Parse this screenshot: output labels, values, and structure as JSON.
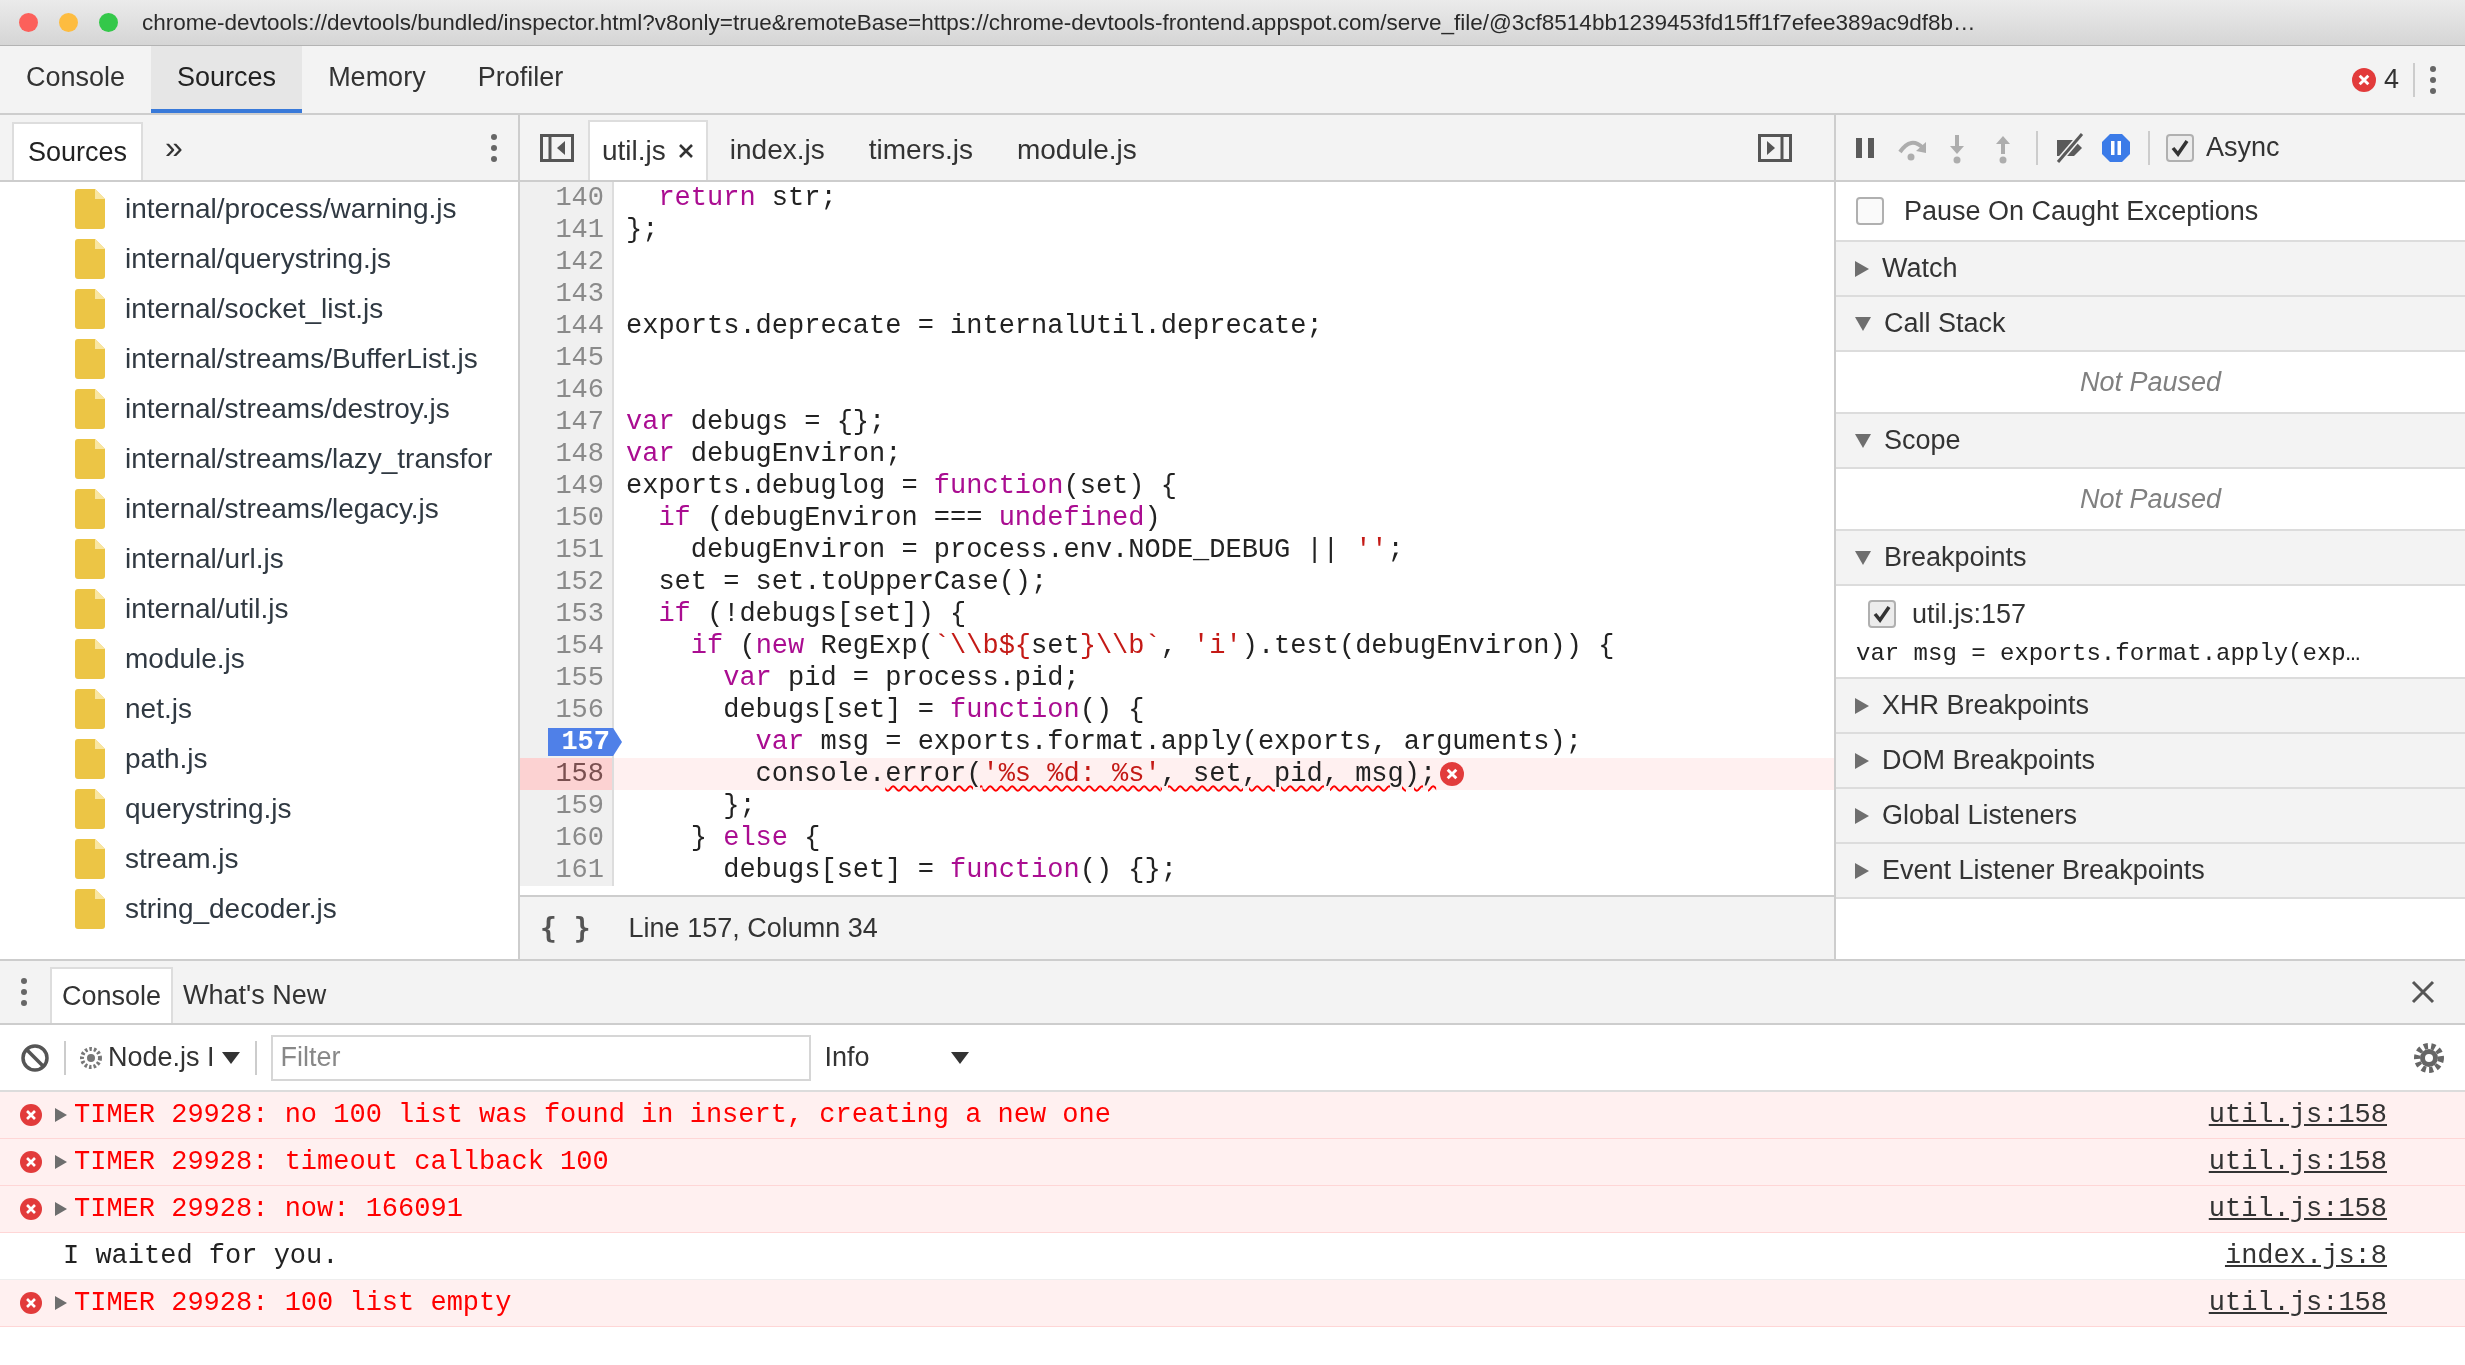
{
  "window": {
    "title": "chrome-devtools://devtools/bundled/inspector.html?v8only=true&remoteBase=https://chrome-devtools-frontend.appspot.com/serve_file/@3cf8514bb1239453fd15ff1f7efee389ac9df8b…"
  },
  "main_tabs": [
    {
      "label": "Console",
      "selected": false
    },
    {
      "label": "Sources",
      "selected": true
    },
    {
      "label": "Memory",
      "selected": false
    },
    {
      "label": "Profiler",
      "selected": false
    }
  ],
  "error_count": "4",
  "navigator": {
    "tabs": [
      {
        "label": "Sources",
        "selected": true
      }
    ],
    "more_tabs": "»",
    "files": [
      "internal/process/warning.js",
      "internal/querystring.js",
      "internal/socket_list.js",
      "internal/streams/BufferList.js",
      "internal/streams/destroy.js",
      "internal/streams/lazy_transfor",
      "internal/streams/legacy.js",
      "internal/url.js",
      "internal/util.js",
      "module.js",
      "net.js",
      "path.js",
      "querystring.js",
      "stream.js",
      "string_decoder.js"
    ]
  },
  "editor": {
    "tabs": [
      {
        "label": "util.js",
        "selected": true
      },
      {
        "label": "index.js",
        "selected": false
      },
      {
        "label": "timers.js",
        "selected": false
      },
      {
        "label": "module.js",
        "selected": false
      }
    ],
    "lines": [
      {
        "number": "140",
        "breakpoint": false,
        "error": false,
        "tokens": [
          {
            "text": "  return",
            "kind": "keyword"
          },
          {
            "text": " str;",
            "kind": "plain"
          }
        ]
      },
      {
        "number": "141",
        "breakpoint": false,
        "error": false,
        "tokens": [
          {
            "text": "};",
            "kind": "plain"
          }
        ]
      },
      {
        "number": "142",
        "breakpoint": false,
        "error": false
      },
      {
        "number": "143",
        "breakpoint": false,
        "error": false
      },
      {
        "number": "144",
        "breakpoint": false,
        "error": false,
        "tokens": [
          {
            "text": "exports.deprecate = internalUtil.deprecate;",
            "kind": "plain"
          }
        ]
      },
      {
        "number": "145",
        "breakpoint": false,
        "error": false
      },
      {
        "number": "146",
        "breakpoint": false,
        "error": false
      },
      {
        "number": "147",
        "breakpoint": false,
        "error": false,
        "tokens": [
          {
            "text": "var",
            "kind": "keyword"
          },
          {
            "text": " debugs = {};",
            "kind": "plain"
          }
        ]
      },
      {
        "number": "148",
        "breakpoint": false,
        "error": false,
        "tokens": [
          {
            "text": "var",
            "kind": "keyword"
          },
          {
            "text": " debugEnviron;",
            "kind": "plain"
          }
        ]
      },
      {
        "number": "149",
        "breakpoint": false,
        "error": false,
        "tokens": [
          {
            "text": "exports.debuglog = ",
            "kind": "plain"
          },
          {
            "text": "function",
            "kind": "keyword"
          },
          {
            "text": "(set) {",
            "kind": "plain"
          }
        ]
      },
      {
        "number": "150",
        "breakpoint": false,
        "error": false,
        "tokens": [
          {
            "text": "  if",
            "kind": "keyword"
          },
          {
            "text": " (debugEnviron === ",
            "kind": "plain"
          },
          {
            "text": "undefined",
            "kind": "keyword"
          },
          {
            "text": ")",
            "kind": "plain"
          }
        ]
      },
      {
        "number": "151",
        "breakpoint": false,
        "error": false,
        "tokens": [
          {
            "text": "    debugEnviron = process.env.NODE_DEBUG || ",
            "kind": "plain"
          },
          {
            "text": "''",
            "kind": "string"
          },
          {
            "text": ";",
            "kind": "plain"
          }
        ]
      },
      {
        "number": "152",
        "breakpoint": false,
        "error": false,
        "tokens": [
          {
            "text": "  set = set.toUpperCase();",
            "kind": "plain"
          }
        ]
      },
      {
        "number": "153",
        "breakpoint": false,
        "error": false,
        "tokens": [
          {
            "text": "  if",
            "kind": "keyword"
          },
          {
            "text": " (!debugs[set]) {",
            "kind": "plain"
          }
        ]
      },
      {
        "number": "154",
        "breakpoint": false,
        "error": false,
        "tokens": [
          {
            "text": "    if",
            "kind": "keyword"
          },
          {
            "text": " (",
            "kind": "plain"
          },
          {
            "text": "new",
            "kind": "keyword"
          },
          {
            "text": " RegExp(",
            "kind": "plain"
          },
          {
            "text": "`\\\\b${",
            "kind": "string"
          },
          {
            "text": "set",
            "kind": "plain"
          },
          {
            "text": "}\\\\b`",
            "kind": "string"
          },
          {
            "text": ", ",
            "kind": "plain"
          },
          {
            "text": "'i'",
            "kind": "string"
          },
          {
            "text": ").test(debugEnviron)) {",
            "kind": "plain"
          }
        ]
      },
      {
        "number": "155",
        "breakpoint": false,
        "error": false,
        "tokens": [
          {
            "text": "      var",
            "kind": "keyword"
          },
          {
            "text": " pid = process.pid;",
            "kind": "plain"
          }
        ]
      },
      {
        "number": "156",
        "breakpoint": false,
        "error": false,
        "tokens": [
          {
            "text": "      debugs[set] = ",
            "kind": "plain"
          },
          {
            "text": "function",
            "kind": "keyword"
          },
          {
            "text": "() {",
            "kind": "plain"
          }
        ]
      },
      {
        "number": "157",
        "breakpoint": true,
        "error": false,
        "tokens": [
          {
            "text": "        var",
            "kind": "keyword"
          },
          {
            "text": " msg = exports.format.apply(exports, arguments);",
            "kind": "plain"
          }
        ]
      },
      {
        "number": "158",
        "breakpoint": false,
        "error": true,
        "tokens": [
          {
            "text": "        console.",
            "kind": "plain"
          },
          {
            "text": "error(",
            "kind": "plain"
          },
          {
            "text": "'%s %d: %s'",
            "kind": "string"
          },
          {
            "text": ", set, pid, msg);",
            "kind": "plain"
          }
        ]
      },
      {
        "number": "159",
        "breakpoint": false,
        "error": false,
        "tokens": [
          {
            "text": "      };",
            "kind": "plain"
          }
        ]
      },
      {
        "number": "160",
        "breakpoint": false,
        "error": false,
        "tokens": [
          {
            "text": "    } ",
            "kind": "plain"
          },
          {
            "text": "else",
            "kind": "keyword"
          },
          {
            "text": " {",
            "kind": "plain"
          }
        ]
      },
      {
        "number": "161",
        "breakpoint": false,
        "error": false,
        "tokens": [
          {
            "text": "      debugs[set] = ",
            "kind": "plain"
          },
          {
            "text": "function",
            "kind": "keyword"
          },
          {
            "text": "() {};",
            "kind": "plain"
          }
        ]
      }
    ],
    "pretty_print": "{ }",
    "status": "Line 157, Column 34"
  },
  "debugger": {
    "toolbar": [
      {
        "kind": "pause",
        "disabled": false,
        "active": false
      },
      {
        "kind": "step-over",
        "disabled": true,
        "active": false
      },
      {
        "kind": "step-into",
        "disabled": true,
        "active": false
      },
      {
        "kind": "step-out",
        "disabled": true,
        "active": false
      },
      {
        "kind": "deactivate",
        "disabled": false,
        "active": false
      },
      {
        "kind": "pause-exceptions",
        "disabled": false,
        "active": true
      }
    ],
    "async": {
      "label": "Async",
      "checked": true
    },
    "pause_on_caught": {
      "label": "Pause On Caught Exceptions",
      "checked": false
    },
    "sections": [
      {
        "title": "Watch",
        "expanded": false
      },
      {
        "title": "Call Stack",
        "expanded": true,
        "message": "Not Paused"
      },
      {
        "title": "Scope",
        "expanded": true,
        "message": "Not Paused"
      },
      {
        "title": "Breakpoints",
        "expanded": true,
        "items": [
          {
            "label": "util.js:157",
            "checked": true,
            "code": "var msg = exports.format.apply(exp…"
          }
        ]
      },
      {
        "title": "XHR Breakpoints",
        "expanded": false
      },
      {
        "title": "DOM Breakpoints",
        "expanded": false
      },
      {
        "title": "Global Listeners",
        "expanded": false
      },
      {
        "title": "Event Listener Breakpoints",
        "expanded": false
      }
    ]
  },
  "drawer": {
    "tabs": [
      {
        "label": "Console",
        "selected": true
      },
      {
        "label": "What's New",
        "selected": false
      }
    ],
    "context": "Node.js I",
    "filter": {
      "placeholder": "Filter"
    },
    "level": "Info",
    "messages": [
      {
        "kind": "error",
        "expandable": true,
        "text": "TIMER 29928: no 100 list was found in insert, creating a new one",
        "source": "util.js:158"
      },
      {
        "kind": "error",
        "expandable": true,
        "text": "TIMER 29928: timeout callback 100",
        "source": "util.js:158"
      },
      {
        "kind": "error",
        "expandable": true,
        "text": "TIMER 29928: now: 166091",
        "source": "util.js:158"
      },
      {
        "kind": "info",
        "expandable": false,
        "text": "I waited for you.",
        "source": "index.js:8"
      },
      {
        "kind": "error",
        "expandable": true,
        "text": "TIMER 29928: 100 list empty",
        "source": "util.js:158"
      }
    ]
  }
}
